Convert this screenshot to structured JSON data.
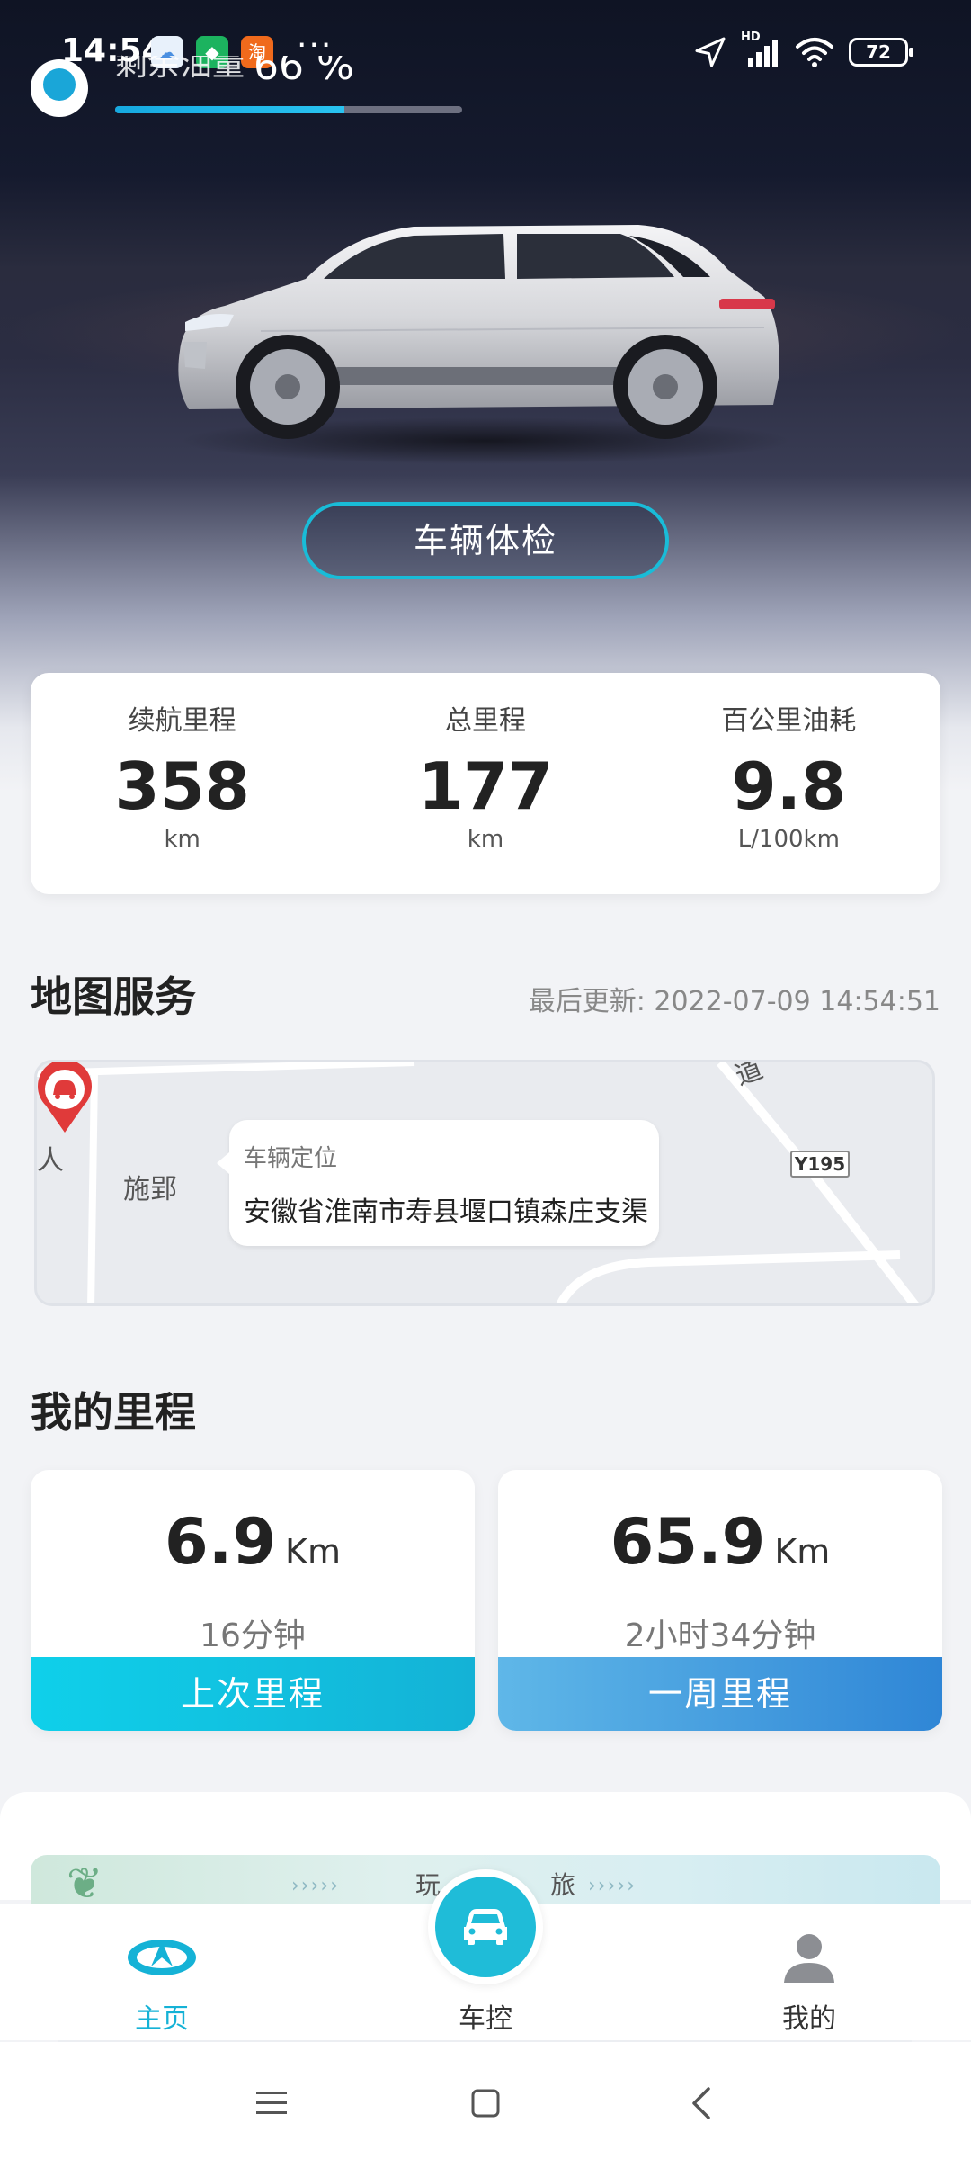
{
  "status_bar": {
    "time": "14:54",
    "apps": [
      "cloud-app-icon",
      "shield-app-icon",
      "taobao-app-icon"
    ],
    "taobao_glyph": "淘",
    "more": "···",
    "network": "HD",
    "battery": "72"
  },
  "fuel": {
    "label": "剩余油量",
    "value": "66 %",
    "fill_percent": 66
  },
  "hero": {
    "check_button": "车辆体检"
  },
  "stats": [
    {
      "label": "续航里程",
      "value": "358",
      "unit": "km"
    },
    {
      "label": "总里程",
      "value": "177",
      "unit": "km"
    },
    {
      "label": "百公里油耗",
      "value": "9.8",
      "unit": "L/100km"
    }
  ],
  "map_section": {
    "title": "地图服务",
    "last_update": "最后更新: 2022-07-09 14:54:51",
    "place_labels": [
      "人",
      "施郢",
      "道"
    ],
    "road_sign": "Y195",
    "bubble_label": "车辆定位",
    "address": "安徽省淮南市寿县堰口镇森庄支渠"
  },
  "mileage_section": {
    "title": "我的里程",
    "cards": [
      {
        "value": "6.9",
        "unit": "Km",
        "time": "16分钟",
        "footer": "上次里程"
      },
      {
        "value": "65.9",
        "unit": "Km",
        "time": "2小时34分钟",
        "footer": "一周里程"
      }
    ]
  },
  "banner": {
    "left_text": "玩",
    "right_text": "旅"
  },
  "bottom_nav": {
    "home": "主页",
    "control": "车控",
    "mine": "我的"
  },
  "colors": {
    "accent": "#1fbcd8",
    "last_trip_gradient": [
      "#0fd0ea",
      "#14b2d6"
    ],
    "week_trip_gradient": [
      "#5fb7e8",
      "#2f86d6"
    ]
  }
}
